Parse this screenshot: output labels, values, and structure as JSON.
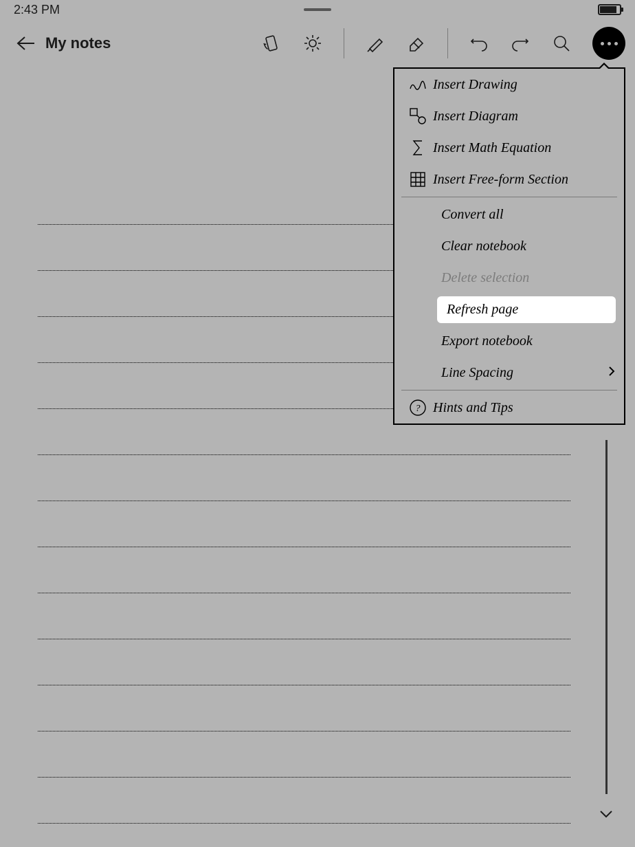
{
  "statusbar": {
    "time": "2:43 PM"
  },
  "header": {
    "title": "My notes"
  },
  "menu": {
    "insert_drawing": "Insert Drawing",
    "insert_diagram": "Insert Diagram",
    "insert_math": "Insert Math Equation",
    "insert_freeform": "Insert Free-form Section",
    "convert_all": "Convert all",
    "clear_notebook": "Clear notebook",
    "delete_selection": "Delete selection",
    "refresh_page": "Refresh page",
    "export_notebook": "Export notebook",
    "line_spacing": "Line Spacing",
    "hints_tips": "Hints and Tips"
  }
}
